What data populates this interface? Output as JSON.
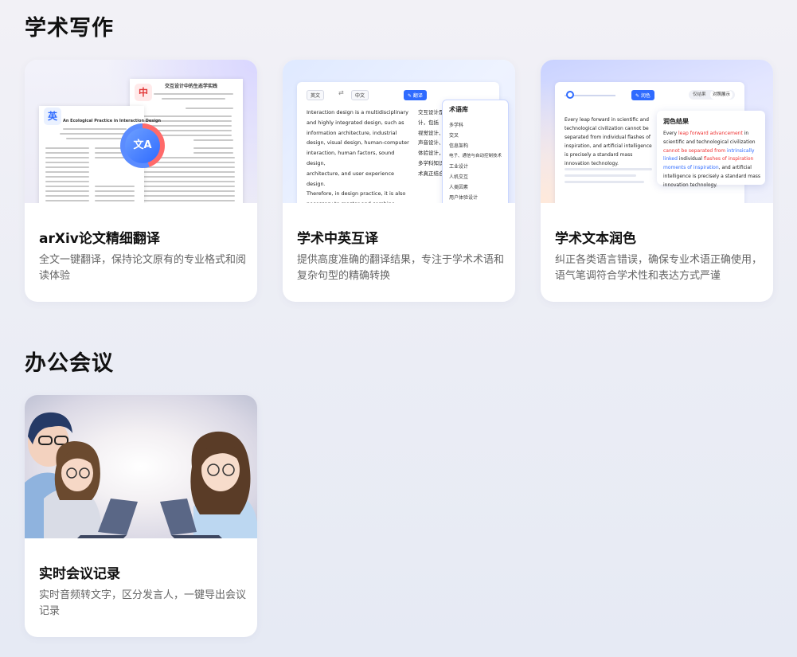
{
  "sections": [
    {
      "title": "学术写作"
    },
    {
      "title": "办公会议"
    }
  ],
  "cards": [
    {
      "title": "arXiv论文精细翻译",
      "desc": "全文一键翻译，保持论文原有的专业格式和阅读体验",
      "thumb": {
        "badge_en": "英",
        "badge_zh": "中",
        "en_title": "An Ecological Practice in Interaction Design",
        "zh_title": "交互设计中的生态学实践",
        "translate_glyph": "文A"
      }
    },
    {
      "title": "学术中英互译",
      "desc": "提供高度准确的翻译结果，专注于学术术语和复杂句型的精确转换",
      "thumb": {
        "source_lang": "英文",
        "target_lang": "中文",
        "swap_symbol": "⇄",
        "mode_button": "✎ 翻译",
        "source_text": "Interaction design is a multidisciplinary\nand highly integrated design, such as\ninformation architecture, industrial\ndesign, visual design, human-computer\ninteraction, human factors, sound design,\narchitecture, and user experience design.\nTherefore, in design practice, it is also\nnecessary to master and combine\nknowledge from multiple disciplines for\ndesign and consideration, so as to truly\nintegrate technology and art.",
        "target_text": "交互设计是一门多学科\n计，包括\n视觉设计、人\n声音设计、\n体验设计，因此\n多学科知识进行设计\n术真正结合起来。",
        "terms_title": "术语库",
        "terms": [
          "多学科",
          "交叉",
          "信息架构",
          "电子、通信与自动控制技术",
          "工业设计",
          "人机交互",
          "人类因素",
          "用户体验设计"
        ]
      }
    },
    {
      "title": "学术文本润色",
      "desc": "纠正各类语言错误，确保专业术语正确使用，语气笔调符合学术性和表达方式严谨",
      "thumb": {
        "mode_button": "✎ 润色",
        "seg_left": "仅结果",
        "seg_right": "对照展示",
        "source_text": "Every leap forward in scientific and technological civilization cannot be separated from individual flashes of inspiration, and artificial intelligence is precisely a standard mass innovation technology.",
        "result_title": "润色结果",
        "result_parts": [
          {
            "t": "Every ",
            "c": ""
          },
          {
            "t": "leap forward advancement",
            "c": "blue"
          },
          {
            "t": " in scientific and technological civilization ",
            "c": ""
          },
          {
            "t": "cannot be separated from",
            "c": "red"
          },
          {
            "t": " intrinsically linked",
            "c": "blue"
          },
          {
            "t": " individual ",
            "c": ""
          },
          {
            "t": "flashes of inspiration",
            "c": "red"
          },
          {
            "t": " moments of inspiration",
            "c": "blue"
          },
          {
            "t": ", and artificial intelligence is precisely a standard mass innovation technology.",
            "c": ""
          }
        ]
      }
    },
    {
      "title": "实时会议记录",
      "desc": "实时音频转文字，区分发言人，一键导出会议记录"
    }
  ],
  "colors": {
    "accent": "#2f6bff",
    "highlight_red": "#e33333",
    "title_text": "#111111",
    "desc_text": "#666666"
  }
}
